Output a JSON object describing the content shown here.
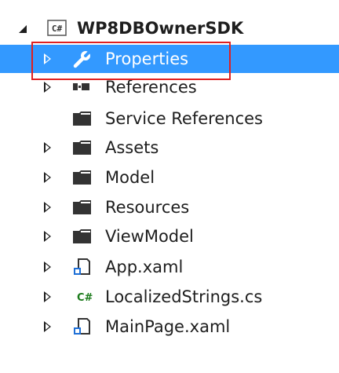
{
  "tree": {
    "project": {
      "label": "WP8DBOwnerSDK",
      "icon": "csharp-project-icon",
      "state": "expanded"
    },
    "items": [
      {
        "label": "Properties",
        "icon": "wrench-icon",
        "state": "collapsed",
        "selected": true
      },
      {
        "label": "References",
        "icon": "references-icon",
        "state": "collapsed"
      },
      {
        "label": "Service References",
        "icon": "folder-icon",
        "state": "none"
      },
      {
        "label": "Assets",
        "icon": "folder-icon",
        "state": "collapsed"
      },
      {
        "label": "Model",
        "icon": "folder-icon",
        "state": "collapsed"
      },
      {
        "label": "Resources",
        "icon": "folder-icon",
        "state": "collapsed"
      },
      {
        "label": "ViewModel",
        "icon": "folder-icon",
        "state": "collapsed"
      },
      {
        "label": "App.xaml",
        "icon": "xaml-file-icon",
        "state": "collapsed"
      },
      {
        "label": "LocalizedStrings.cs",
        "icon": "csharp-file-icon",
        "state": "collapsed"
      },
      {
        "label": "MainPage.xaml",
        "icon": "xaml-file-icon",
        "state": "collapsed"
      }
    ],
    "cs_badge": "C#"
  },
  "colors": {
    "selection": "#3399ff",
    "highlight_border": "#e02020",
    "text": "#1e1e1e"
  }
}
